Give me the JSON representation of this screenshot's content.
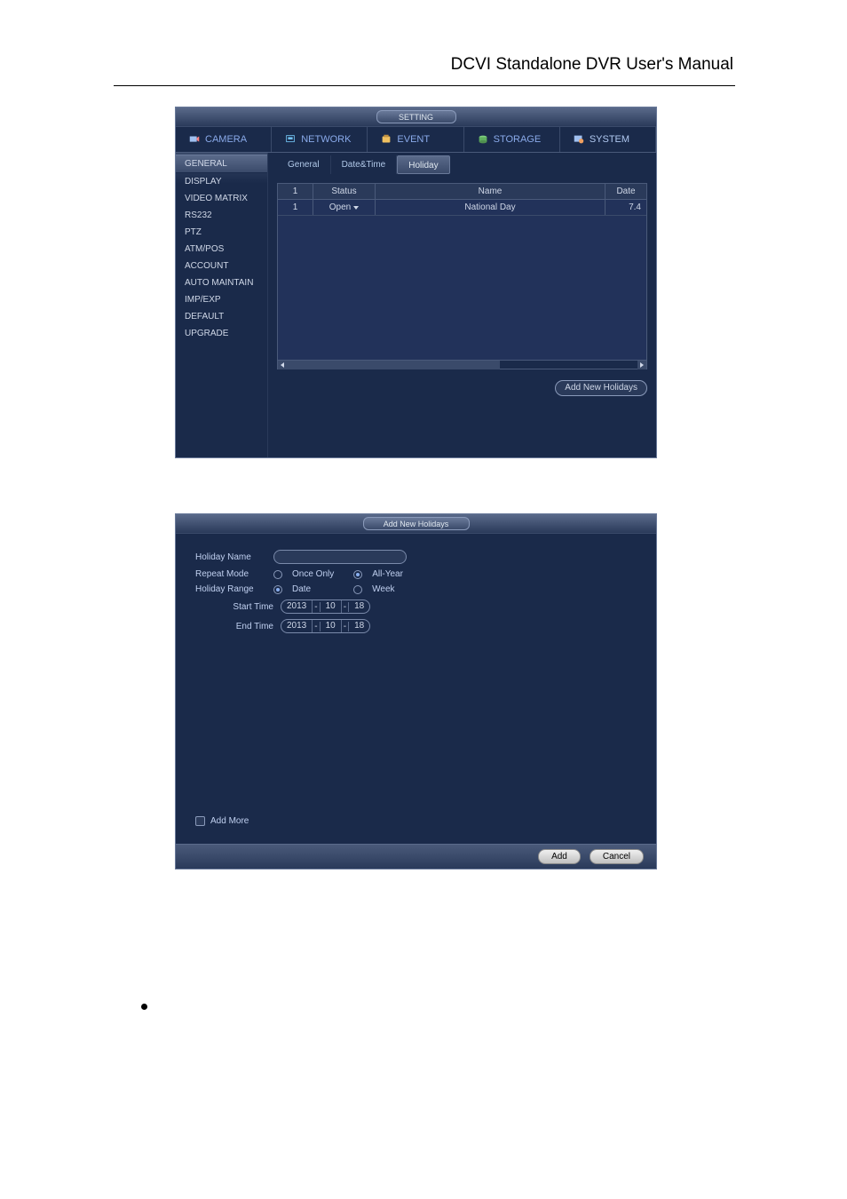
{
  "document": {
    "header_title": "DCVI Standalone DVR User's Manual"
  },
  "window1": {
    "title": "SETTING",
    "tabs": [
      {
        "label": "CAMERA"
      },
      {
        "label": "NETWORK"
      },
      {
        "label": "EVENT"
      },
      {
        "label": "STORAGE"
      },
      {
        "label": "SYSTEM"
      }
    ],
    "sidebar": [
      "GENERAL",
      "DISPLAY",
      "VIDEO MATRIX",
      "RS232",
      "PTZ",
      "ATM/POS",
      "ACCOUNT",
      "AUTO MAINTAIN",
      "IMP/EXP",
      "DEFAULT",
      "UPGRADE"
    ],
    "subtabs": [
      "General",
      "Date&Time",
      "Holiday"
    ],
    "table": {
      "headers": [
        "1",
        "Status",
        "Name",
        "Date"
      ],
      "row": {
        "num": "1",
        "status": "Open",
        "name": "National Day",
        "date": "7.4"
      }
    },
    "add_button": "Add New Holidays"
  },
  "window2": {
    "title": "Add New Holidays",
    "labels": {
      "holiday_name": "Holiday Name",
      "repeat_mode": "Repeat Mode",
      "holiday_range": "Holiday Range",
      "start_time": "Start Time",
      "end_time": "End Time",
      "add_more": "Add More"
    },
    "repeat_options": [
      "Once Only",
      "All-Year"
    ],
    "range_options": [
      "Date",
      "Week"
    ],
    "start_date": {
      "y": "2013",
      "m": "10",
      "d": "18"
    },
    "end_date": {
      "y": "2013",
      "m": "10",
      "d": "18"
    },
    "buttons": {
      "add": "Add",
      "cancel": "Cancel"
    }
  }
}
